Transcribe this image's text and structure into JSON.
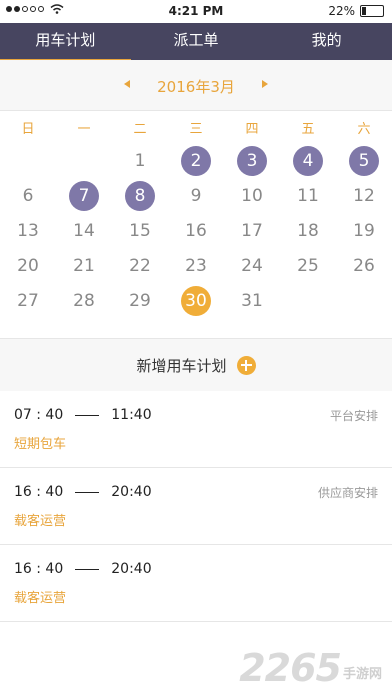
{
  "status_bar": {
    "time": "4:21 PM",
    "battery": "22%",
    "battery_level": 0.22,
    "signal_dots_filled": 2,
    "signal_dots_total": 5
  },
  "tabs": [
    {
      "label": "用车计划",
      "active": true
    },
    {
      "label": "派工单",
      "active": false
    },
    {
      "label": "我的",
      "active": false
    }
  ],
  "calendar": {
    "month_title": "2016年3月",
    "weekdays": [
      "日",
      "一",
      "二",
      "三",
      "四",
      "五",
      "六"
    ],
    "weeks": [
      [
        {
          "d": ""
        },
        {
          "d": ""
        },
        {
          "d": "1"
        },
        {
          "d": "2",
          "s": "planned"
        },
        {
          "d": "3",
          "s": "planned"
        },
        {
          "d": "4",
          "s": "planned"
        },
        {
          "d": "5",
          "s": "planned"
        }
      ],
      [
        {
          "d": "6"
        },
        {
          "d": "7",
          "s": "planned"
        },
        {
          "d": "8",
          "s": "planned"
        },
        {
          "d": "9"
        },
        {
          "d": "10"
        },
        {
          "d": "11"
        },
        {
          "d": "12"
        }
      ],
      [
        {
          "d": "13"
        },
        {
          "d": "14"
        },
        {
          "d": "15"
        },
        {
          "d": "16"
        },
        {
          "d": "17"
        },
        {
          "d": "18"
        },
        {
          "d": "19"
        }
      ],
      [
        {
          "d": "20"
        },
        {
          "d": "21"
        },
        {
          "d": "22"
        },
        {
          "d": "23"
        },
        {
          "d": "24"
        },
        {
          "d": "25"
        },
        {
          "d": "26"
        }
      ],
      [
        {
          "d": "27"
        },
        {
          "d": "28"
        },
        {
          "d": "29"
        },
        {
          "d": "30",
          "s": "today"
        },
        {
          "d": "31"
        },
        {
          "d": ""
        },
        {
          "d": ""
        }
      ]
    ]
  },
  "add_plan": {
    "label": "新增用车计划"
  },
  "plans": [
    {
      "start": "07 : 40",
      "end": "11:40",
      "source": "平台安排",
      "type": "短期包车"
    },
    {
      "start": "16 : 40",
      "end": "20:40",
      "source": "供应商安排",
      "type": "载客运营"
    },
    {
      "start": "16 : 40",
      "end": "20:40",
      "source": "",
      "type": "载客运营"
    }
  ],
  "watermark": {
    "number": "2265",
    "text": "手游网"
  },
  "colors": {
    "nav_bg": "#474560",
    "accent": "#e8a53c",
    "planned": "#7f78a8",
    "today": "#f0ad38"
  }
}
